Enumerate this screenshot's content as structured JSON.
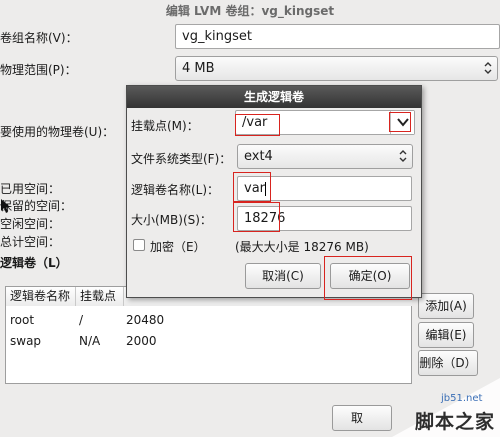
{
  "window": {
    "title": "编辑 LVM 卷组：vg_kingset"
  },
  "vg": {
    "name_label": "卷组名称(V)：",
    "name_value": "vg_kingset",
    "extent_label": "物理范围(P)：",
    "extent_value": "4 MB",
    "pv_label": "要使用的物理卷(U)：",
    "space_labels": [
      "已用空间：",
      "保留的空间：",
      "空闲空间：",
      "总计空间："
    ],
    "lv_section_label": "逻辑卷（L）"
  },
  "lv_table": {
    "headers": [
      "逻辑卷名称",
      "挂载点",
      ""
    ],
    "rows": [
      {
        "name": "root",
        "mount": "/",
        "size": "20480"
      },
      {
        "name": "swap",
        "mount": "N/A",
        "size": "2000"
      }
    ]
  },
  "side_buttons": {
    "add": "添加(A)",
    "edit": "编辑(E)",
    "delete": "删除（D）"
  },
  "bottom": {
    "cancel_partial": "取"
  },
  "dialog": {
    "title": "生成逻辑卷",
    "mount_label": "挂载点(M)：",
    "mount_value": "/var",
    "fstype_label": "文件系统类型(F)：",
    "fstype_value": "ext4",
    "lvname_label": "逻辑卷名称(L)：",
    "lvname_value": "var",
    "size_label": "大小(MB)(S)：",
    "size_value": "18276",
    "encrypt_label": "加密（E）",
    "max_size_text": "(最大大小是 18276 MB)",
    "cancel": "取消(C)",
    "ok": "确定(O)"
  },
  "watermark": {
    "site": "jb51.net",
    "name": "脚本之家"
  },
  "colors": {
    "highlight_box": "#d8241f",
    "dialog_title_bg": "#3a3a3a"
  }
}
